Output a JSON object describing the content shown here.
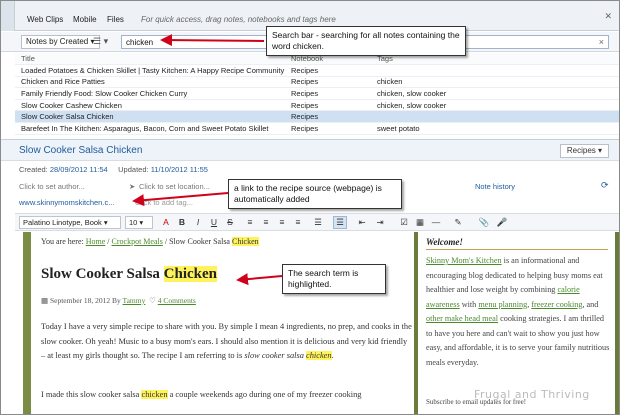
{
  "shortcut_bar": {
    "items": [
      "Web Clips",
      "Mobile",
      "Files"
    ],
    "hint": "For quick access, drag notes, notebooks and tags here"
  },
  "list_toolbar": {
    "sort_label": "Notes by Created ▾",
    "view_icon": "☰ ▾",
    "search_value": "chicken",
    "clear_icon": "×"
  },
  "notes_table": {
    "headers": [
      "Title",
      "Notebook",
      "Tags"
    ],
    "rows": [
      {
        "title": "Loaded Potatoes & Chicken Skillet | Tasty Kitchen: A Happy Recipe Community!",
        "notebook": "Recipes",
        "tags": ""
      },
      {
        "title": "Chicken and Rice Patties",
        "notebook": "Recipes",
        "tags": "chicken"
      },
      {
        "title": "Family Friendly Food: Slow Cooker Chicken Curry",
        "notebook": "Recipes",
        "tags": "chicken, slow cooker"
      },
      {
        "title": "Slow Cooker Cashew Chicken",
        "notebook": "Recipes",
        "tags": "chicken, slow cooker"
      },
      {
        "title": "Slow Cooker Salsa Chicken",
        "notebook": "Recipes",
        "tags": ""
      },
      {
        "title": "Barefeet In The Kitchen: Asparagus, Bacon, Corn and Sweet Potato Skillet",
        "notebook": "Recipes",
        "tags": "sweet potato"
      }
    ],
    "selected_index": 4
  },
  "note": {
    "title": "Slow Cooker Salsa Chicken",
    "notebook_button": "Recipes ▾",
    "created_label": "Created:",
    "created_value": "28/09/2012 11:54",
    "updated_label": "Updated:",
    "updated_value": "11/10/2012 11:55",
    "author_placeholder": "Click to set author...",
    "location_placeholder": "Click to set location...",
    "note_history": "Note history",
    "source_url": "www.skinnymomskitchen.c...",
    "tag_placeholder": "Click to add tag..."
  },
  "format_bar": {
    "font": "Palatino Linotype, Book ▾",
    "size": "10 ▾",
    "buttons": [
      "A",
      "B",
      "I",
      "U",
      "S",
      "≡",
      "≡",
      "≡",
      "≡",
      "☰",
      "☰",
      "⇤",
      "⇥",
      "☑",
      "▦",
      "—",
      "✎",
      "📎",
      "🎤"
    ]
  },
  "article": {
    "breadcrumb_prefix": "You are here:",
    "crumb_home": "Home",
    "crumb_sep": "/",
    "crumb_cat": "Crockpot Meals",
    "crumb_cur_pre": "Slow Cooker Salsa",
    "crumb_cur_hl": "Chicken",
    "heading_pre": "Slow Cooker Salsa",
    "heading_hl": "Chicken",
    "date": "September 18, 2012 By",
    "author": "Tammy",
    "comments": "4 Comments",
    "para1": "Today I have a very simple recipe to share with you. By simple I mean 4 ingredients, no prep, and cooks in the slow cooker. Oh yeah! Music to a busy mom's ears. I should also mention it is delicious and very kid friendly – at least my girls thought so. The recipe I am referring to is",
    "para1_italic": "slow cooker salsa",
    "para1_hl": "chicken",
    "para2_pre": "I made this slow cooker salsa",
    "para2_hl": "chicken",
    "para2_post": "a couple weekends ago during one of my freezer cooking"
  },
  "sidebar": {
    "title": "Welcome!",
    "link1": "Skinny Mom's Kitchen",
    "text1": "is an informational and encouraging blog dedicated to helping busy moms eat healthier and lose weight by combining",
    "link2": "calorie awareness",
    "text2": "with",
    "link3": "menu planning",
    "link4": "freezer cooking",
    "text3": "and",
    "link5": "other make head meal",
    "text4": "cooking strategies. I am thrilled to have you here and can't wait to show you just how easy, and affordable, it is to serve your family nutritious meals everyday.",
    "subscribe": "Subscribe to email updates for free!"
  },
  "watermark": "Frugal and Thriving",
  "callouts": {
    "search": "Search bar - searching for all notes containing the word chicken.",
    "source": "a link to the recipe source (webpage) is automatically added",
    "highlight": "The search term is highlighted."
  },
  "colors": {
    "accent": "#1f5a9c",
    "highlight": "#fff35c",
    "arrow": "#d0021b",
    "page_border": "#6a7b3a"
  }
}
